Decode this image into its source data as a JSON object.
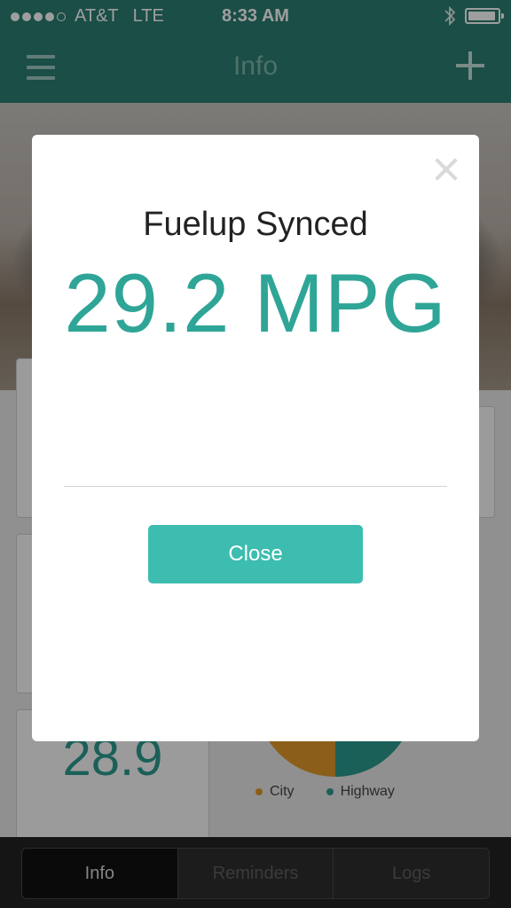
{
  "status_bar": {
    "carrier": "AT&T",
    "network": "LTE",
    "time": "8:33 AM",
    "signal_bars_filled": 4,
    "signal_bars_total": 5,
    "icons": [
      "bluetooth-icon",
      "battery-icon"
    ],
    "battery_level": 0.95
  },
  "nav": {
    "title": "Info",
    "left_icon": "menu-icon",
    "right_icon": "plus-icon"
  },
  "background": {
    "stat_value": "28.9",
    "legend": [
      {
        "label": "City",
        "color": "#e09a2a"
      },
      {
        "label": "Highway",
        "color": "#2c9b8f"
      }
    ]
  },
  "tabs": [
    {
      "label": "Info",
      "active": true
    },
    {
      "label": "Reminders",
      "active": false
    },
    {
      "label": "Logs",
      "active": false
    }
  ],
  "modal": {
    "title": "Fuelup Synced",
    "mpg": "29.2 MPG",
    "button_label": "Close",
    "close_icon": "close-icon"
  },
  "colors": {
    "brand": "#2a7e72",
    "accent": "#3dbdb0",
    "mpg_text": "#2fa597"
  }
}
